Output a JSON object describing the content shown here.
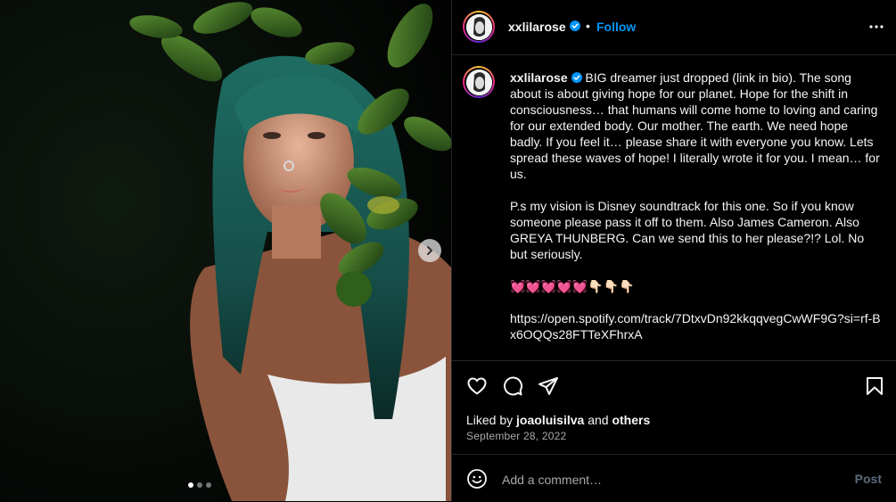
{
  "post": {
    "username": "xxlilarose",
    "follow_label": "Follow",
    "header_separator": "•",
    "caption_paragraphs": [
      "BIG dreamer just dropped (link in bio). The song about is about giving hope for our planet. Hope for the shift in consciousness… that humans will come home to loving and caring for our extended body. Our mother. The earth. We need hope badly. If you feel it… please share it with everyone you know. Lets spread these waves of hope! I literally wrote it for you. I mean… for us.",
      "P.s my vision is Disney soundtrack for this one. So if you know someone please pass it off to them. Also James Cameron. Also GREYA THUNBERG. Can we send this to her please?!? Lol. No but seriously.",
      "💓💓💓💓💓👇🏻👇🏻👇🏻",
      "https://open.spotify.com/track/7DtxvDn92kkqqvegCwWF9G?si=rf-Bx6OQQs28FTTeXFhrxA"
    ],
    "liked_by_prefix": "Liked by",
    "liked_by_user": "joaoluisilva",
    "liked_by_and": "and",
    "liked_by_others": "others",
    "date": "September 28, 2022",
    "comment_placeholder": "Add a comment…",
    "post_label": "Post",
    "carousel": {
      "count": 3,
      "active_index": 0
    }
  },
  "icons": {
    "verified": "verified-badge-icon",
    "more": "more-horizontal-icon",
    "like": "heart-icon",
    "comment": "comment-icon",
    "share": "share-icon",
    "save": "bookmark-icon",
    "emoji": "emoji-icon",
    "next": "chevron-right-icon"
  },
  "colors": {
    "accent": "#0095f6",
    "background": "#000000",
    "divider": "#262626",
    "muted": "#a8a8a8",
    "post_disabled": "#5a6c7e"
  }
}
